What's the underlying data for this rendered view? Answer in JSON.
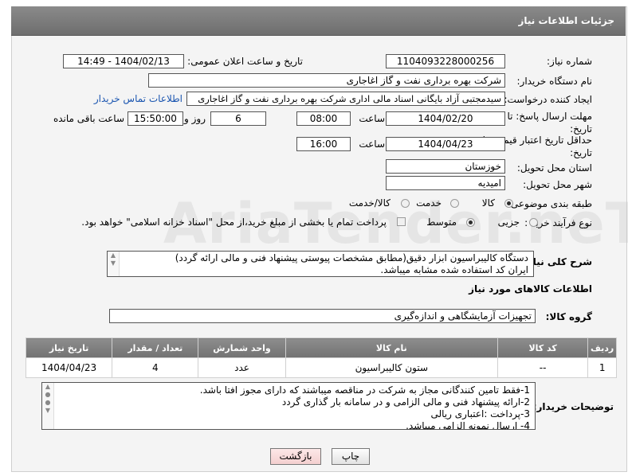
{
  "header": {
    "title": "جزئیات اطلاعات نیاز"
  },
  "form": {
    "need_number_label": "شماره نیاز:",
    "need_number": "1104093228000256",
    "announce_label": "تاریخ و ساعت اعلان عمومی:",
    "announce_value": "1404/02/13 - 14:49",
    "buyer_org_label": "نام دستگاه خریدار:",
    "buyer_org": "شرکت بهره برداری نفت و گاز اغاجاری",
    "creator_label": "ایجاد کننده درخواست:",
    "creator": "سیدمجتبی آزاد بایگانی اسناد مالی اداری شرکت بهره برداری نفت و گاز اغاجاری",
    "contact_link": "اطلاعات تماس خریدار",
    "deadline_label": "مهلت ارسال پاسخ: تا تاریخ:",
    "deadline_date": "1404/02/20",
    "time_label": "ساعت",
    "deadline_time": "08:00",
    "days_value": "6",
    "days_label": "روز و",
    "remaining_time": "15:50:00",
    "remaining_label": "ساعت باقی مانده",
    "validity_label": "حداقل تاریخ اعتبار قیمت: تا تاریخ:",
    "validity_date": "1404/04/23",
    "validity_time_label": "ساعت",
    "validity_time": "16:00",
    "province_label": "استان محل تحویل:",
    "province": "خوزستان",
    "city_label": "شهر محل تحویل:",
    "city": "امیدیه",
    "category_label": "طبقه بندی موضوعی:",
    "category_options": [
      "کالا",
      "خدمت",
      "کالا/خدمت"
    ],
    "process_label": "نوع فرآیند خرید :",
    "process_options": [
      "جزیی",
      "متوسط"
    ],
    "payment_note": "پرداخت تمام یا بخشی از مبلغ خرید،از محل \"اسناد خزانه اسلامی\" خواهد بود."
  },
  "description": {
    "label": "شرح کلی نیاز:",
    "line1": "دستگاه کالیبراسیون ابزار دقیق(مطابق مشخصات پیوستی پیشنهاد فنی و مالی ارائه گردد)",
    "line2": "ایران کد استفاده شده مشابه میباشد."
  },
  "goods_section_title": "اطلاعات کالاهای مورد نیاز",
  "goods_group_label": "گروه کالا:",
  "goods_group": "تجهیزات آزمایشگاهی و اندازه‌گیری",
  "table": {
    "headers": [
      "ردیف",
      "کد کالا",
      "نام کالا",
      "واحد شمارش",
      "تعداد / مقدار",
      "تاریخ نیاز"
    ],
    "rows": [
      [
        "1",
        "--",
        "ستون کالیبراسیون",
        "عدد",
        "4",
        "1404/04/23"
      ]
    ]
  },
  "buyer_notes": {
    "label": "توضیحات خریدار:",
    "lines": [
      "1-فقط تامین کنندگانی مجاز به شرکت در مناقصه میباشند  که دارای مجوز افتا باشد.",
      "2-ارائه پیشنهاد فنی و مالی الزامی و در سامانه بار گذاری گردد",
      "3-پرداخت :اعتباری ریالی",
      "4-  ارسال نمونه الزامی میباشد."
    ]
  },
  "buttons": {
    "print": "چاپ",
    "back": "بازگشت"
  },
  "watermark": "AriaTender.neT",
  "colors": {
    "header_bg": "#7a7a7a",
    "link": "#1a55b0",
    "back_btn": "#f8d9d9"
  }
}
